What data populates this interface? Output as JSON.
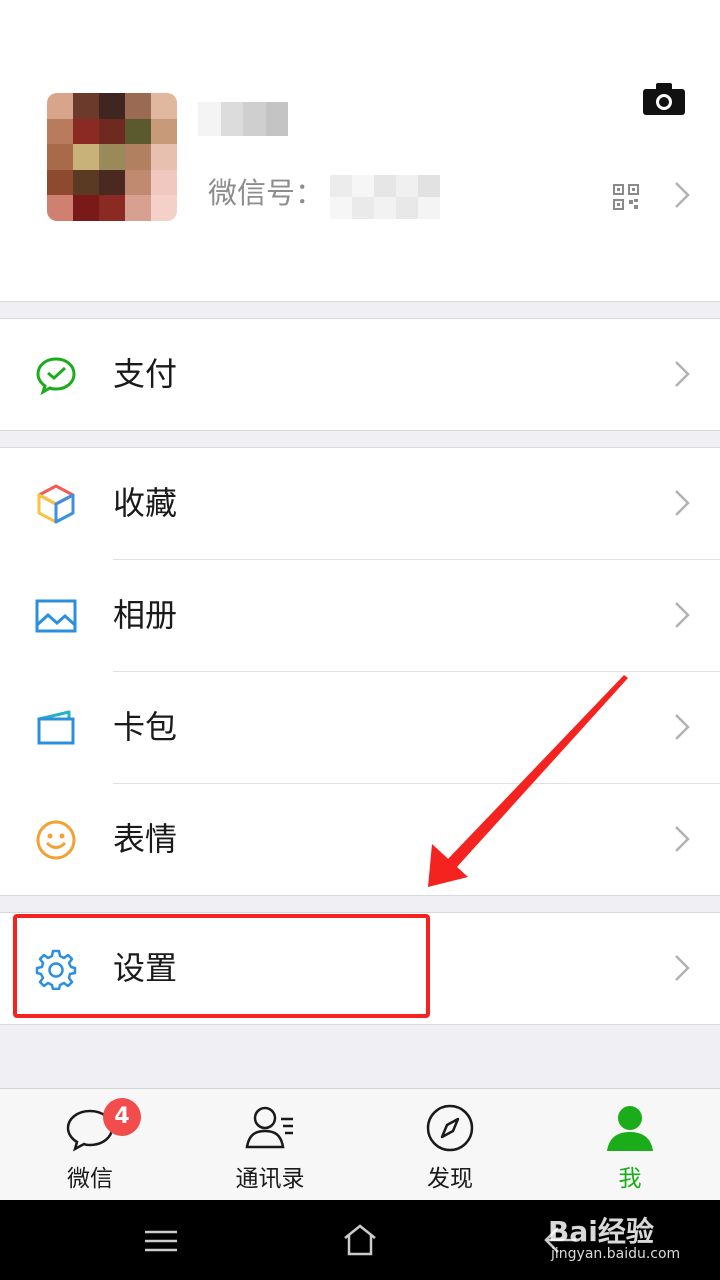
{
  "profile": {
    "wechat_id_label": "微信号："
  },
  "menu": {
    "pay": "支付",
    "favorites": "收藏",
    "album": "相册",
    "cards": "卡包",
    "stickers": "表情",
    "settings": "设置"
  },
  "tabs": {
    "chats": "微信",
    "chats_badge": "4",
    "contacts": "通讯录",
    "discover": "发现",
    "me": "我"
  },
  "colors": {
    "accent": "#1aad19",
    "badge": "#f24c4c",
    "highlight": "#f5231f"
  },
  "watermark": {
    "brand": "Bai经验",
    "url": "jingyan.baidu.com"
  }
}
